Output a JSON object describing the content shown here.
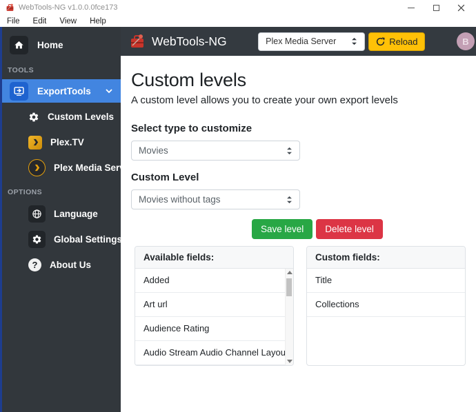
{
  "window": {
    "title": "WebTools-NG v1.0.0.0fce173",
    "menu": [
      "File",
      "Edit",
      "View",
      "Help"
    ]
  },
  "header": {
    "app_name": "WebTools-NG",
    "server_selector": {
      "value": "Plex Media Server"
    },
    "reload": {
      "label": "Reload"
    },
    "avatar": {
      "initial": "B"
    }
  },
  "sidebar": {
    "home": "Home",
    "tools_section": "TOOLS",
    "export_tools": "ExportTools",
    "custom_levels": "Custom Levels",
    "plex_tv": "Plex.TV",
    "plex_media_server": "Plex Media Server",
    "options_section": "OPTIONS",
    "language": "Language",
    "global_settings": "Global Settings",
    "about_us": "About Us"
  },
  "icons": {
    "question_mark": "?"
  },
  "main": {
    "title": "Custom levels",
    "subtitle": "A custom level allows you to create your own export levels",
    "type_section": {
      "label": "Select type to customize",
      "selected": "Movies"
    },
    "level_section": {
      "label": "Custom Level",
      "selected": "Movies without tags"
    },
    "buttons": {
      "save": "Save level",
      "delete": "Delete level"
    },
    "available_fields": {
      "title": "Available fields:",
      "items": [
        "Added",
        "Art url",
        "Audience Rating",
        "Audio Stream Audio Channel Layout"
      ]
    },
    "custom_fields": {
      "title": "Custom fields:",
      "items": [
        "Title",
        "Collections"
      ]
    }
  },
  "colors": {
    "accent_blue": "#4285e0",
    "header_dark": "#343a40",
    "sidebar_dark": "#32373c",
    "plex_gold": "#e5a00d",
    "save_green": "#28a745",
    "delete_red": "#dc3545",
    "reload_yellow": "#ffc107",
    "right_scrollbar_blue": "#1d3fa0",
    "avatar_pink": "#c39fb4"
  }
}
